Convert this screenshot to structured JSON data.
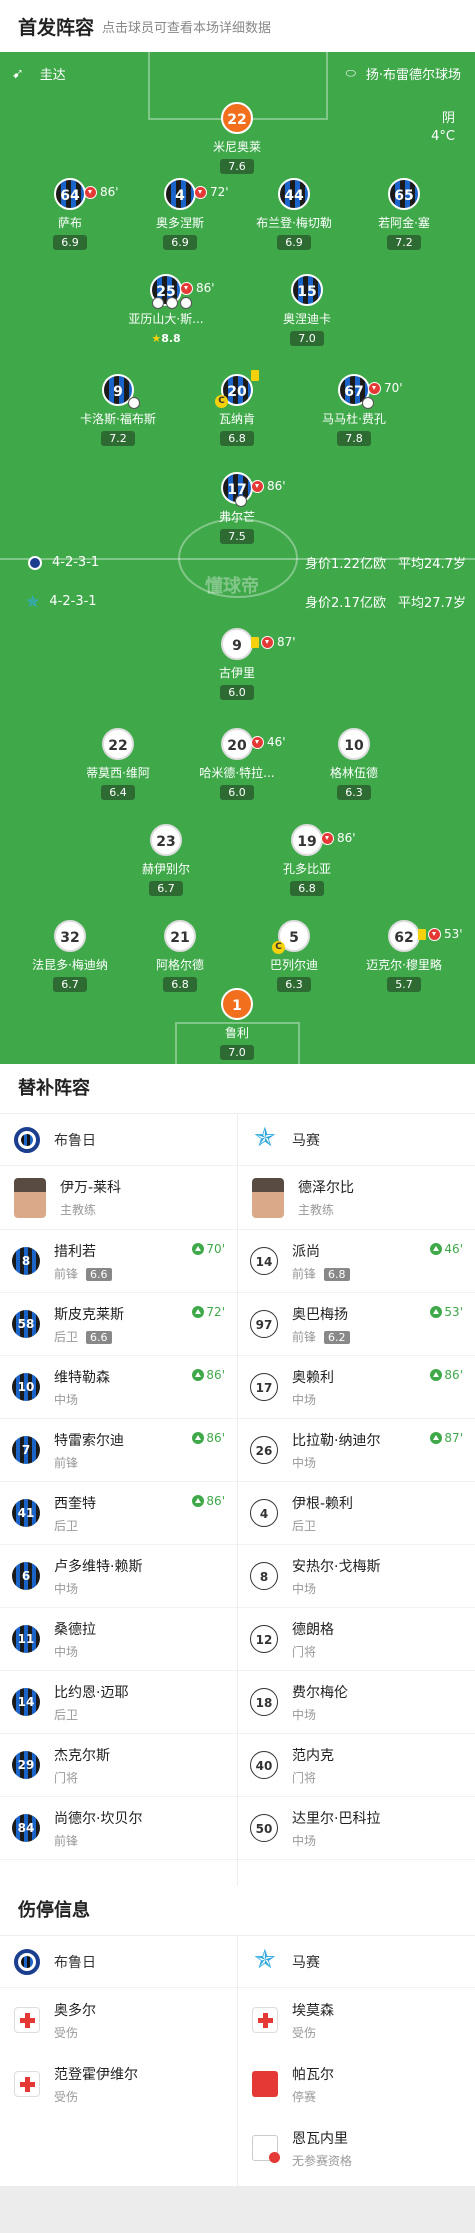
{
  "header": {
    "title": "首发阵容",
    "subtitle": "点击球员可查看本场详细数据"
  },
  "match": {
    "home_team": "圭达",
    "venue": "扬·布雷德尔球场",
    "weather": "阴",
    "temperature": "4°C"
  },
  "formations": {
    "home": {
      "formation": "4-2-3-1",
      "value": "身价1.22亿欧",
      "avg_age": "平均24.7岁"
    },
    "away": {
      "formation": "4-2-3-1",
      "value": "身价2.17亿欧",
      "avg_age": "平均27.7岁"
    }
  },
  "watermark": "懂球帝",
  "home_players": [
    {
      "number": "22",
      "name": "米尼奥莱",
      "rating": "7.6",
      "kit": "gk1"
    },
    {
      "number": "64",
      "name": "萨布",
      "rating": "6.9",
      "sub_out": "86'"
    },
    {
      "number": "4",
      "name": "奥多涅斯",
      "rating": "6.9",
      "sub_out": "72'"
    },
    {
      "number": "44",
      "name": "布兰登·梅切勒",
      "rating": "6.9"
    },
    {
      "number": "65",
      "name": "若阿金·塞",
      "rating": "7.2"
    },
    {
      "number": "25",
      "name": "亚历山大·斯...",
      "rating": "8.8",
      "sub_out": "86'",
      "star": "true"
    },
    {
      "number": "15",
      "name": "奥涅迪卡",
      "rating": "7.0"
    },
    {
      "number": "9",
      "name": "卡洛斯·福布斯",
      "rating": "7.2"
    },
    {
      "number": "20",
      "name": "瓦纳肯",
      "rating": "6.8",
      "captain": "C"
    },
    {
      "number": "67",
      "name": "马马杜·费孔",
      "rating": "7.8",
      "sub_out": "70'"
    },
    {
      "number": "17",
      "name": "弗尔芒",
      "rating": "7.5",
      "sub_out": "86'"
    }
  ],
  "away_players": [
    {
      "number": "9",
      "name": "古伊里",
      "rating": "6.0",
      "sub_out": "87'"
    },
    {
      "number": "22",
      "name": "蒂莫西·维阿",
      "rating": "6.4"
    },
    {
      "number": "20",
      "name": "哈米德·特拉...",
      "rating": "6.0",
      "sub_out": "46'"
    },
    {
      "number": "10",
      "name": "格林伍德",
      "rating": "6.3"
    },
    {
      "number": "23",
      "name": "赫伊别尔",
      "rating": "6.7"
    },
    {
      "number": "19",
      "name": "孔多比亚",
      "rating": "6.8",
      "sub_out": "86'"
    },
    {
      "number": "32",
      "name": "法昆多·梅迪纳",
      "rating": "6.7"
    },
    {
      "number": "21",
      "name": "阿格尔德",
      "rating": "6.8"
    },
    {
      "number": "5",
      "name": "巴列尔迪",
      "rating": "6.3",
      "captain": "C"
    },
    {
      "number": "62",
      "name": "迈克尔·穆里略",
      "rating": "5.7",
      "sub_out": "53'"
    },
    {
      "number": "1",
      "name": "鲁利",
      "rating": "7.0",
      "kit": "gk2"
    }
  ],
  "subs": {
    "title": "替补阵容",
    "home_team": "布鲁日",
    "away_team": "马赛",
    "home_coach": {
      "name": "伊万-莱科",
      "role": "主教练"
    },
    "away_coach": {
      "name": "德泽尔比",
      "role": "主教练"
    },
    "home": [
      {
        "number": "8",
        "name": "措利若",
        "pos": "前锋",
        "rating": "6.6",
        "in": "70'"
      },
      {
        "number": "58",
        "name": "斯皮克莱斯",
        "pos": "后卫",
        "rating": "6.6",
        "in": "72'"
      },
      {
        "number": "10",
        "name": "维特勒森",
        "pos": "中场",
        "in": "86'"
      },
      {
        "number": "7",
        "name": "特雷索尔迪",
        "pos": "前锋",
        "in": "86'"
      },
      {
        "number": "41",
        "name": "西奎特",
        "pos": "后卫",
        "in": "86'"
      },
      {
        "number": "6",
        "name": "卢多维特·赖斯",
        "pos": "中场"
      },
      {
        "number": "11",
        "name": "桑德拉",
        "pos": "中场"
      },
      {
        "number": "14",
        "name": "比约恩·迈耶",
        "pos": "后卫"
      },
      {
        "number": "29",
        "name": "杰克尔斯",
        "pos": "门将"
      },
      {
        "number": "84",
        "name": "尚德尔·坎贝尔",
        "pos": "前锋"
      }
    ],
    "away": [
      {
        "number": "14",
        "name": "派尚",
        "pos": "前锋",
        "rating": "6.8",
        "in": "46'"
      },
      {
        "number": "97",
        "name": "奥巴梅扬",
        "pos": "前锋",
        "rating": "6.2",
        "in": "53'"
      },
      {
        "number": "17",
        "name": "奥赖利",
        "pos": "中场",
        "in": "86'"
      },
      {
        "number": "26",
        "name": "比拉勒·纳迪尔",
        "pos": "中场",
        "in": "87'"
      },
      {
        "number": "4",
        "name": "伊根-赖利",
        "pos": "后卫"
      },
      {
        "number": "8",
        "name": "安热尔·戈梅斯",
        "pos": "中场"
      },
      {
        "number": "12",
        "name": "德朗格",
        "pos": "门将"
      },
      {
        "number": "18",
        "name": "费尔梅伦",
        "pos": "中场"
      },
      {
        "number": "40",
        "name": "范内克",
        "pos": "门将"
      },
      {
        "number": "50",
        "name": "达里尔·巴科拉",
        "pos": "中场"
      }
    ]
  },
  "injuries": {
    "title": "伤停信息",
    "home_team": "布鲁日",
    "away_team": "马赛",
    "home": [
      {
        "name": "奥多尔",
        "status": "受伤",
        "icon": "medical-icon"
      },
      {
        "name": "范登霍伊维尔",
        "status": "受伤",
        "icon": "medical-icon"
      }
    ],
    "away": [
      {
        "name": "埃莫森",
        "status": "受伤",
        "icon": "medical-icon"
      },
      {
        "name": "帕瓦尔",
        "status": "停赛",
        "icon": "red-card-icon"
      },
      {
        "name": "恩瓦内里",
        "status": "无参赛资格",
        "icon": "ineligible-icon"
      }
    ]
  },
  "colors": {
    "pitch": "#3fa94a",
    "sub_in": "#3fa94a",
    "sub_out": "#e53935",
    "gk": "#f26f1e"
  }
}
